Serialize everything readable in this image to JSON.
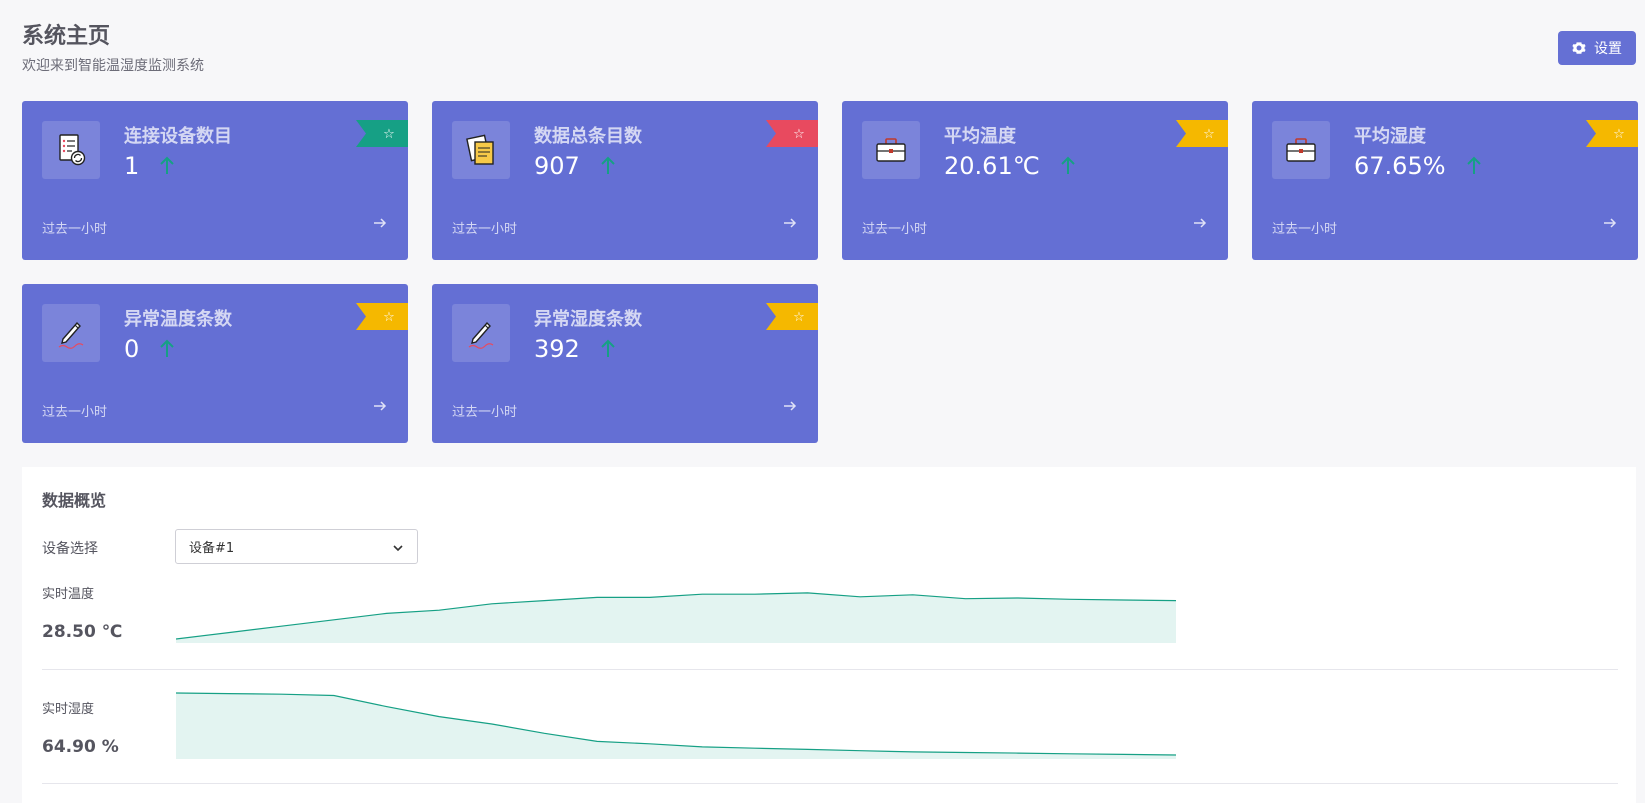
{
  "header": {
    "title": "系统主页",
    "subtitle": "欢迎来到智能温湿度监测系统",
    "settings_label": "设置"
  },
  "colors": {
    "card_bg": "#646fd4",
    "accent_green": "#16a085",
    "ribbon_teal": "#16a085",
    "ribbon_red": "#e84a5f",
    "ribbon_yellow": "#f5b800",
    "chart_line": "#16a085",
    "chart_fill": "#e3f4f1"
  },
  "cards": [
    {
      "title": "连接设备数目",
      "value": "1",
      "footer": "过去一小时",
      "icon": "device-list-icon",
      "ribbon": "#16a085"
    },
    {
      "title": "数据总条目数",
      "value": "907",
      "footer": "过去一小时",
      "icon": "notes-icon",
      "ribbon": "#e84a5f"
    },
    {
      "title": "平均温度",
      "value": "20.61℃",
      "footer": "过去一小时",
      "icon": "briefcase-icon",
      "ribbon": "#f5b800"
    },
    {
      "title": "平均湿度",
      "value": "67.65%",
      "footer": "过去一小时",
      "icon": "briefcase-icon",
      "ribbon": "#f5b800"
    },
    {
      "title": "异常温度条数",
      "value": "0",
      "footer": "过去一小时",
      "icon": "pencil-icon",
      "ribbon": "#f5b800"
    },
    {
      "title": "异常湿度条数",
      "value": "392",
      "footer": "过去一小时",
      "icon": "pencil-icon",
      "ribbon": "#f5b800"
    }
  ],
  "overview": {
    "title": "数据概览",
    "select_label": "设备选择",
    "selected_device": "设备#1",
    "temperature": {
      "label": "实时温度",
      "value": "28.50 ℃",
      "series": [
        0.0,
        0.1,
        0.2,
        0.3,
        0.4,
        0.45,
        0.55,
        0.6,
        0.65,
        0.65,
        0.7,
        0.7,
        0.72,
        0.66,
        0.69,
        0.63,
        0.64,
        0.62,
        0.61,
        0.6
      ]
    },
    "humidity": {
      "label": "实时湿度",
      "value": "64.90 %",
      "series": [
        1.0,
        0.99,
        0.98,
        0.96,
        0.78,
        0.62,
        0.5,
        0.35,
        0.22,
        0.18,
        0.13,
        0.11,
        0.09,
        0.07,
        0.05,
        0.04,
        0.03,
        0.02,
        0.01,
        0.0
      ]
    }
  }
}
